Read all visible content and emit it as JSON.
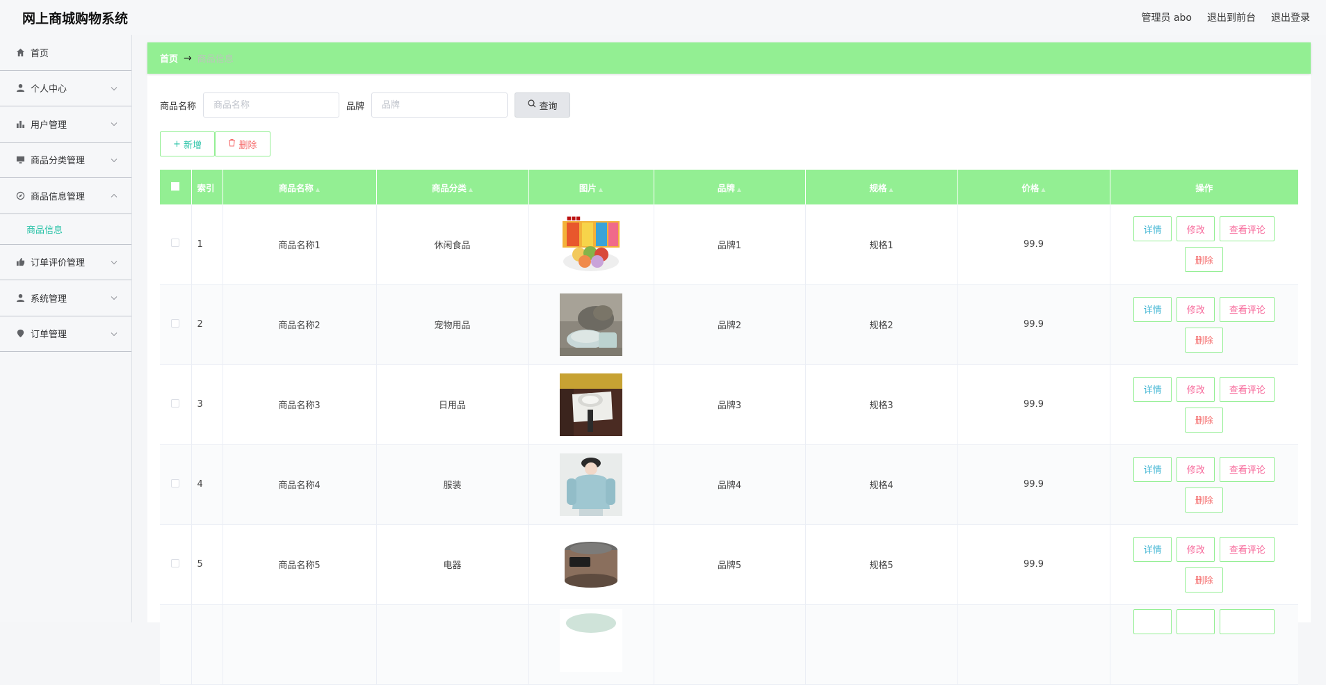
{
  "app": {
    "title": "网上商城购物系统"
  },
  "header": {
    "admin": "管理员 abo",
    "to_front": "退出到前台",
    "logout": "退出登录"
  },
  "sidebar": {
    "items": [
      {
        "label": "首页",
        "icon": "home-icon"
      },
      {
        "label": "个人中心",
        "icon": "user-icon"
      },
      {
        "label": "用户管理",
        "icon": "bar-chart-icon"
      },
      {
        "label": "商品分类管理",
        "icon": "monitor-icon"
      },
      {
        "label": "商品信息管理",
        "icon": "compass-icon"
      },
      {
        "label": "订单评价管理",
        "icon": "thumb-up-icon"
      },
      {
        "label": "系统管理",
        "icon": "user-icon"
      },
      {
        "label": "订单管理",
        "icon": "location-icon"
      }
    ],
    "subitem": "商品信息"
  },
  "breadcrumb": {
    "home": "首页",
    "sep": "→",
    "current": "商品信息"
  },
  "search": {
    "name_label": "商品名称",
    "name_placeholder": "商品名称",
    "brand_label": "品牌",
    "brand_placeholder": "品牌",
    "query_label": "查询"
  },
  "actions": {
    "add_label": "新增",
    "delete_label": "删除"
  },
  "table": {
    "columns": [
      "索引",
      "商品名称",
      "商品分类",
      "图片",
      "品牌",
      "规格",
      "价格",
      "操作"
    ],
    "ops": {
      "detail": "详情",
      "edit": "修改",
      "review": "查看评论",
      "delete": "删除"
    },
    "rows": [
      {
        "index": "1",
        "name": "商品名称1",
        "category": "休闲食品",
        "brand": "品牌1",
        "spec": "规格1",
        "price": "99.9",
        "image": "snack-image"
      },
      {
        "index": "2",
        "name": "商品名称2",
        "category": "宠物用品",
        "brand": "品牌2",
        "spec": "规格2",
        "price": "99.9",
        "image": "pet-image"
      },
      {
        "index": "3",
        "name": "商品名称3",
        "category": "日用品",
        "brand": "品牌3",
        "spec": "规格3",
        "price": "99.9",
        "image": "daily-image"
      },
      {
        "index": "4",
        "name": "商品名称4",
        "category": "服装",
        "brand": "品牌4",
        "spec": "规格4",
        "price": "99.9",
        "image": "clothing-image"
      },
      {
        "index": "5",
        "name": "商品名称5",
        "category": "电器",
        "brand": "品牌5",
        "spec": "规格5",
        "price": "99.9",
        "image": "appliance-image"
      }
    ]
  },
  "colors": {
    "accent_green": "#93ef93",
    "teal": "#2bc3a8",
    "pink": "#f7689a",
    "red": "#f56c6c",
    "blue": "#47b8d5"
  }
}
